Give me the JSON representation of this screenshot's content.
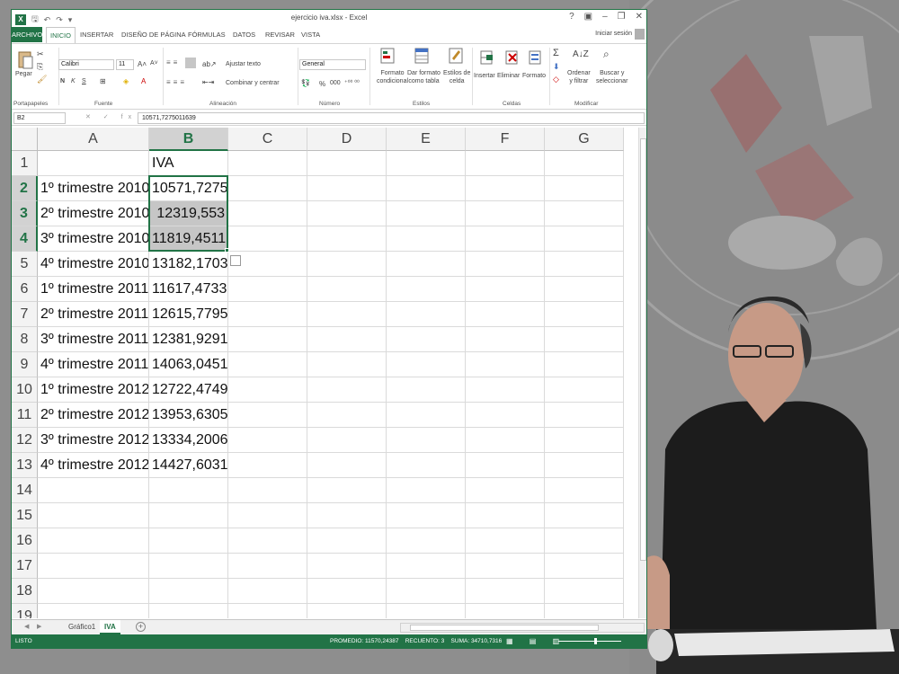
{
  "app": {
    "window_title": "ejercicio iva.xlsx - Excel",
    "logo_letter": "X",
    "signin": "Iniciar sesión",
    "controls": [
      "?",
      "▣",
      "–",
      "❐",
      "✕"
    ]
  },
  "tabs": [
    "ARCHIVO",
    "INICIO",
    "INSERTAR",
    "DISEÑO DE PÁGINA",
    "FÓRMULAS",
    "DATOS",
    "REVISAR",
    "VISTA"
  ],
  "ribbon": {
    "clipboard": {
      "paste_label": "Pegar",
      "group_label": "Portapapeles"
    },
    "font": {
      "name": "Calibri",
      "size": "11",
      "bold": "N",
      "italic": "K",
      "underline": "S",
      "group_label": "Fuente"
    },
    "alignment": {
      "wrap_text": "Ajustar texto",
      "merge": "Combinar y centrar",
      "group_label": "Alineación"
    },
    "number": {
      "format": "General",
      "percent": "%",
      "thousands": "000",
      "group_label": "Número"
    },
    "styles": {
      "cond_format_1": "Formato",
      "cond_format_2": "condicional",
      "table_1": "Dar formato",
      "table_2": "como tabla",
      "cell_styles_1": "Estilos de",
      "cell_styles_2": "celda",
      "group_label": "Estilos"
    },
    "cells": {
      "insert": "Insertar",
      "delete": "Eliminar",
      "format": "Formato",
      "group_label": "Celdas"
    },
    "editing": {
      "sort_1": "Ordenar",
      "sort_2": "y filtrar",
      "find_1": "Buscar y",
      "find_2": "seleccionar",
      "group_label": "Modificar"
    }
  },
  "formula_bar": {
    "name_box": "B2",
    "icons": "✕ ✓ fx",
    "formula": "10571,7275011639"
  },
  "grid": {
    "columns": [
      "A",
      "B",
      "C",
      "D",
      "E",
      "F",
      "G"
    ],
    "rows": [
      "1",
      "2",
      "3",
      "4",
      "5",
      "6",
      "7",
      "8",
      "9",
      "10",
      "11",
      "12",
      "13",
      "14",
      "15",
      "16",
      "17",
      "18",
      "19"
    ],
    "header_b": "IVA",
    "data": [
      [
        "1º trimestre 2010",
        "10571,7275"
      ],
      [
        "2º trimestre 2010",
        "12319,553"
      ],
      [
        "3º trimestre 2010",
        "11819,4511"
      ],
      [
        "4º trimestre 2010",
        "13182,1703"
      ],
      [
        "1º trimestre 2011",
        "11617,4733"
      ],
      [
        "2º trimestre 2011",
        "12615,7795"
      ],
      [
        "3º trimestre 2011",
        "12381,9291"
      ],
      [
        "4º trimestre 2011",
        "14063,0451"
      ],
      [
        "1º trimestre 2012",
        "12722,4749"
      ],
      [
        "2º trimestre 2012",
        "13953,6305"
      ],
      [
        "3º trimestre 2012",
        "13334,2006"
      ],
      [
        "4º trimestre 2012",
        "14427,6031"
      ]
    ]
  },
  "sheets": [
    "Gráfico1",
    "IVA"
  ],
  "add_sheet": "+",
  "status": {
    "ready": "LISTO",
    "average": "PROMEDIO: 11570,24387",
    "count": "RECUENTO: 3",
    "sum": "SUMA: 34710,7316",
    "views": "▦ ▤ ▥"
  },
  "colors": {
    "excel_green": "#217346",
    "selection_gray": "#c6c6c6"
  }
}
